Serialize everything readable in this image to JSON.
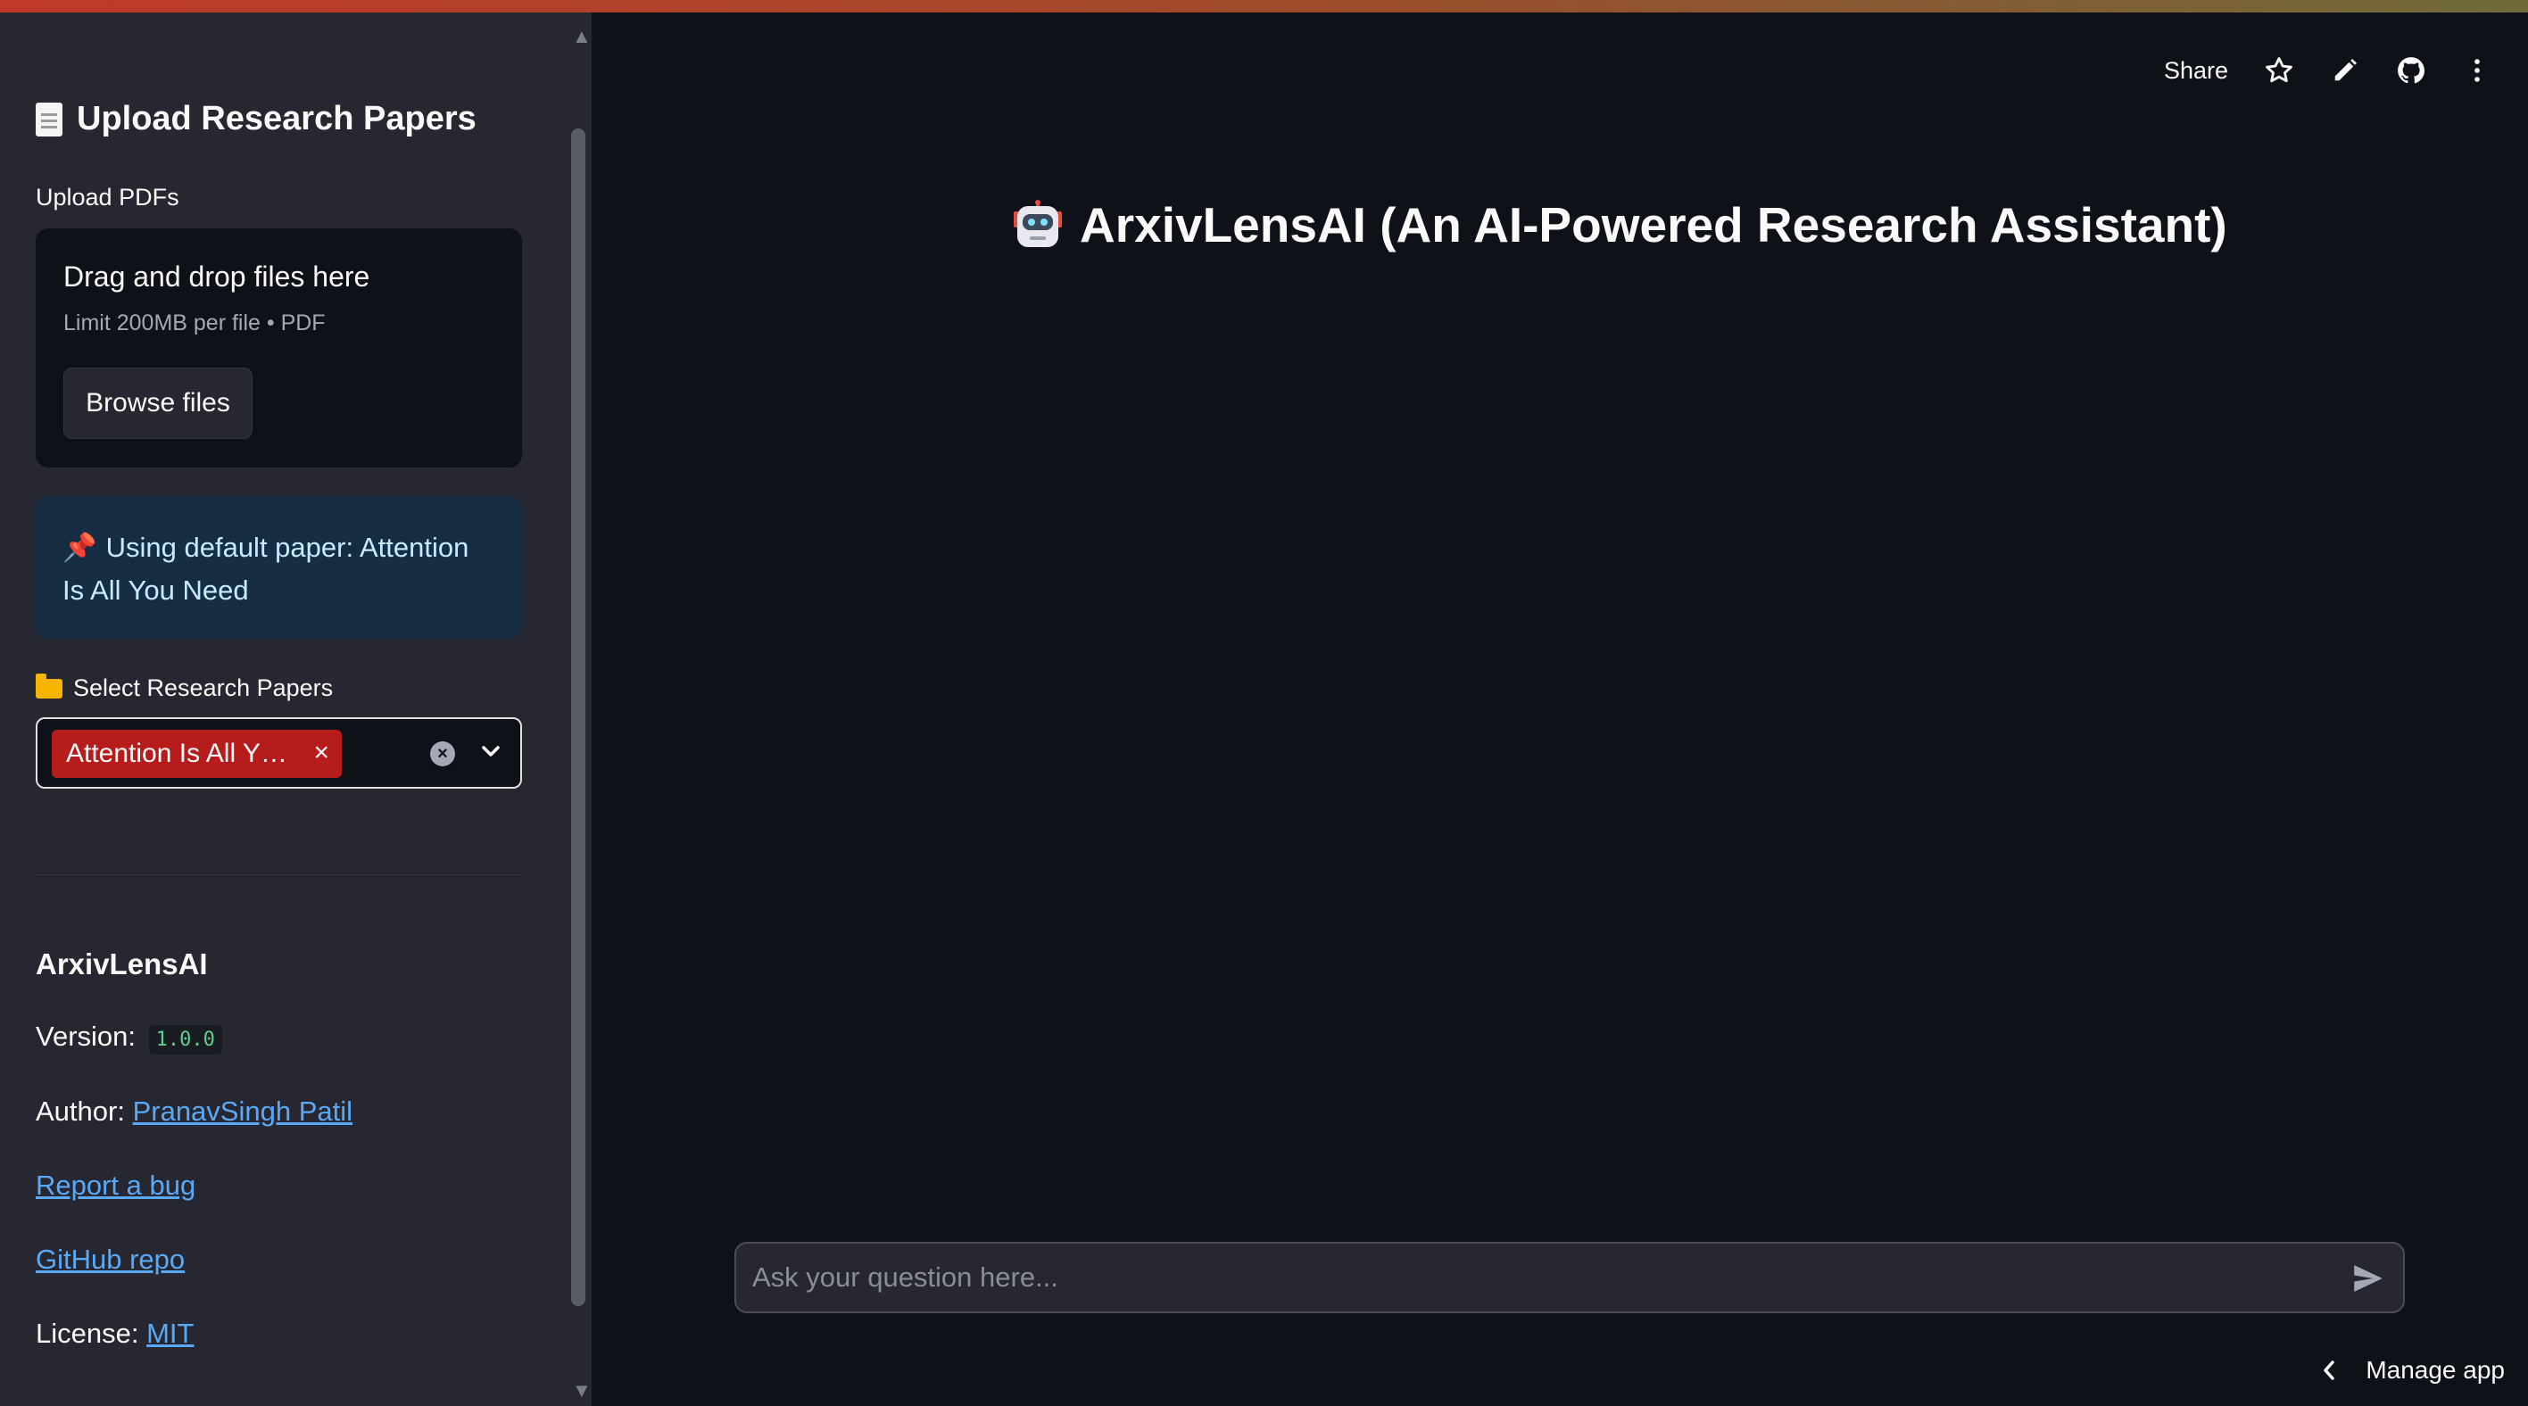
{
  "sidebar": {
    "title": "Upload Research Papers",
    "title_icon": "document-icon",
    "upload_label": "Upload PDFs",
    "dropzone": {
      "title": "Drag and drop files here",
      "subtitle": "Limit 200MB per file • PDF",
      "browse_label": "Browse files"
    },
    "info": {
      "icon": "pushpin-icon",
      "text": "Using default paper: Attention Is All You Need"
    },
    "select": {
      "label_icon": "folder-icon",
      "label": "Select Research Papers",
      "tags": [
        "Attention Is All You Need"
      ],
      "tag_display": "Attention Is All Y…"
    },
    "about": {
      "title": "ArxivLensAI",
      "version_label": "Version:",
      "version": "1.0.0",
      "author_label": "Author:",
      "author": "PranavSingh Patil",
      "report_bug": "Report a bug",
      "github_repo": "GitHub repo",
      "license_label": "License:",
      "license": "MIT"
    }
  },
  "toolbar": {
    "share_label": "Share",
    "icons": [
      "star-icon",
      "pencil-icon",
      "github-icon",
      "more-vert-icon"
    ]
  },
  "main": {
    "title_icon": "robot-icon",
    "title": "ArxivLensAI (An AI-Powered Research Assistant)"
  },
  "chat": {
    "placeholder": "Ask your question here..."
  },
  "footer": {
    "manage_label": "Manage app"
  },
  "colors": {
    "background": "#0e1117",
    "sidebar": "#262730",
    "tag": "#b71c1c",
    "info_bg": "#172d43",
    "info_text": "#c7ebff",
    "link": "#5aa9f7",
    "code": "#5ed08e"
  }
}
